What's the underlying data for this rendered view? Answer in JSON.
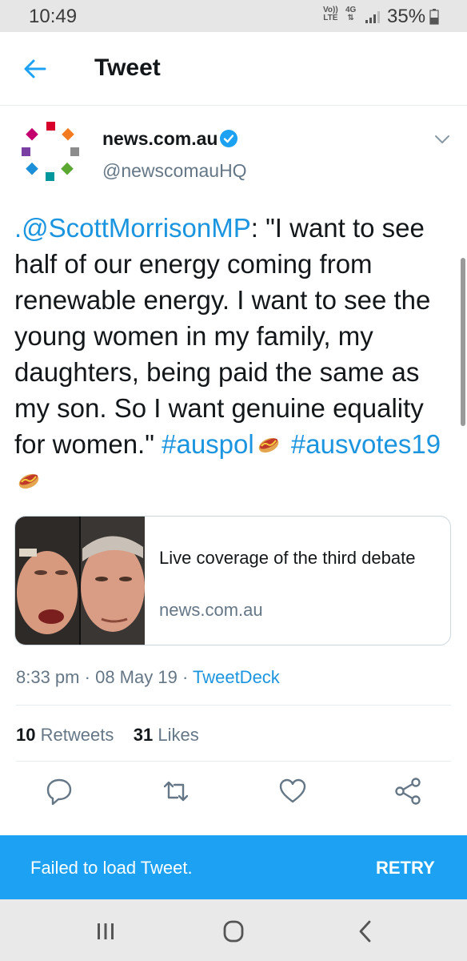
{
  "status_bar": {
    "time": "10:49",
    "volte_top": "Vo))",
    "volte_bottom": "LTE",
    "network": "4G",
    "battery": "35%"
  },
  "header": {
    "title": "Tweet",
    "back_icon": "arrow-left-icon"
  },
  "tweet": {
    "author_name": "news.com.au",
    "author_handle": "@newscomauHQ",
    "mention": ".@ScottMorrisonMP",
    "body": ": \"I want to see half of our energy coming from renewable energy. I want to see the young women in my family, my daughters, being paid the same as my son. So I want genuine equality for women.\"",
    "hashtags": [
      "#auspol",
      "#ausvotes19"
    ],
    "card": {
      "title": "Live coverage of the third debate",
      "domain": "news.com.au"
    },
    "time": "8:33 pm",
    "date": "08 May 19",
    "source": "TweetDeck",
    "retweets_count": "10",
    "retweets_label": "Retweets",
    "likes_count": "31",
    "likes_label": "Likes"
  },
  "actions": [
    "reply-icon",
    "retweet-icon",
    "like-icon",
    "share-icon"
  ],
  "snackbar": {
    "message": "Failed to load Tweet.",
    "action": "RETRY"
  },
  "colors": {
    "accent": "#1da1f2",
    "link": "#1b95e0",
    "secondary_text": "#657786"
  }
}
